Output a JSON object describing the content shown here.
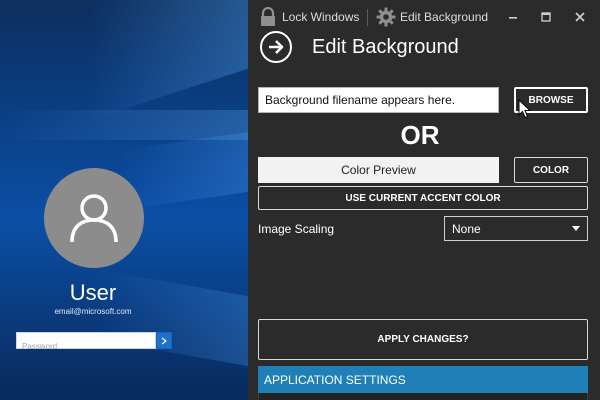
{
  "lock_screen": {
    "user_name": "User",
    "user_email": "email@microsoft.com",
    "password_placeholder": "Password",
    "submit_icon": "arrow-right-icon",
    "accent_color": "#1f6fcf"
  },
  "titlebar": {
    "lock_windows_label": "Lock Windows",
    "lock_icon": "lock-icon",
    "edit_background_label": "Edit Background",
    "gear_icon": "gear-icon",
    "controls": [
      "minimize-icon",
      "maximize-icon",
      "close-icon"
    ]
  },
  "page": {
    "title": "Edit Background",
    "back_icon": "arrow-right-circle-icon"
  },
  "background": {
    "filename_text": "Background filename appears here.",
    "browse_label": "BROWSE",
    "or_label": "OR",
    "color_preview_label": "Color Preview",
    "color_label": "COLOR",
    "accent_label": "USE CURRENT ACCENT COLOR",
    "scaling_label": "Image Scaling",
    "scaling_value": "None",
    "apply_label": "APPLY CHANGES?"
  },
  "application_settings": {
    "header": "APPLICATION SETTINGS",
    "header_color": "#1f80b8"
  },
  "colors": {
    "panel_bg": "#2b2b2b",
    "text": "#ffffff"
  }
}
